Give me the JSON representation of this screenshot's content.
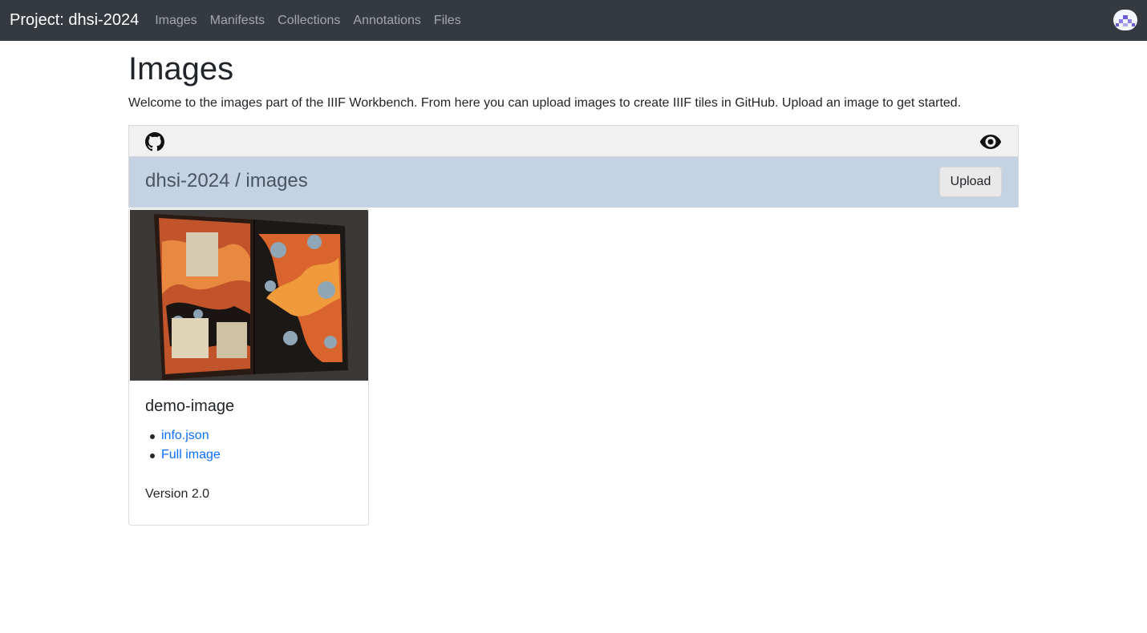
{
  "navbar": {
    "brand": "Project: dhsi-2024",
    "links": [
      "Images",
      "Manifests",
      "Collections",
      "Annotations",
      "Files"
    ]
  },
  "page": {
    "title": "Images",
    "intro": "Welcome to the images part of the IIIF Workbench. From here you can upload images to create IIIF tiles in GitHub. Upload an image to get started."
  },
  "repo": {
    "title": "dhsi-2024 / images",
    "upload_label": "Upload",
    "icons": [
      "github-icon",
      "eye-icon"
    ]
  },
  "cards": [
    {
      "title": "demo-image",
      "links": [
        "info.json",
        "Full image"
      ],
      "version": "Version 2.0"
    }
  ],
  "colors": {
    "navbar_bg": "#343a40",
    "repo_bar_bg": "#c3d3e3",
    "link": "#0d6efd"
  }
}
